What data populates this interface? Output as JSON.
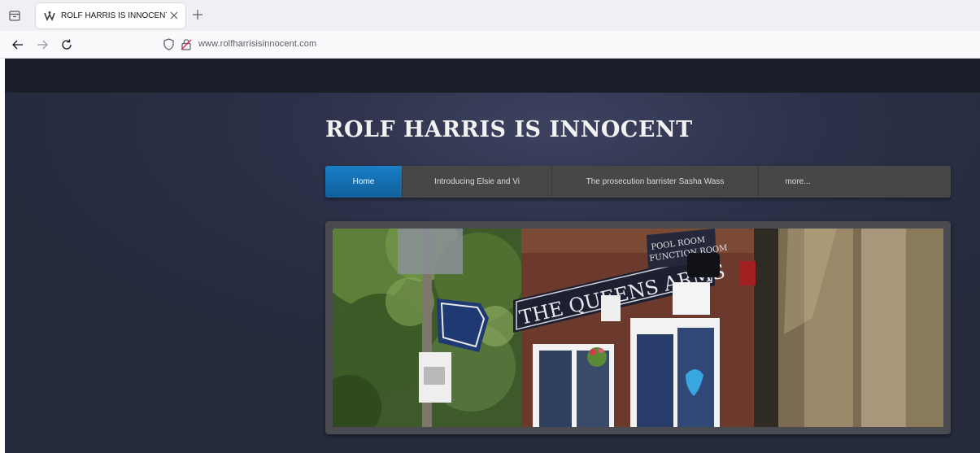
{
  "browser": {
    "tab": {
      "title": "ROLF HARRIS IS INNOCENT - H"
    },
    "address_bar": {
      "url": "www.rolfharrisisinnocent.com"
    }
  },
  "site": {
    "title": "ROLF HARRIS IS INNOCENT",
    "nav": [
      {
        "label": "Home",
        "active": true
      },
      {
        "label": "Introducing Elsie and Vi",
        "active": false
      },
      {
        "label": "The prosecution barrister Sasha Wass",
        "active": false
      },
      {
        "label": "more...",
        "active": false
      }
    ],
    "photo": {
      "sign_main": "THE QUEENS ARMS",
      "sign_side_1": "POOL ROOM",
      "sign_side_2": "FUNCTION ROOM"
    }
  },
  "colors": {
    "page_background": "#2b2f45",
    "menu_background": "#474747",
    "menu_active": "#1a7fc7",
    "title_text": "#f2f2f2"
  }
}
